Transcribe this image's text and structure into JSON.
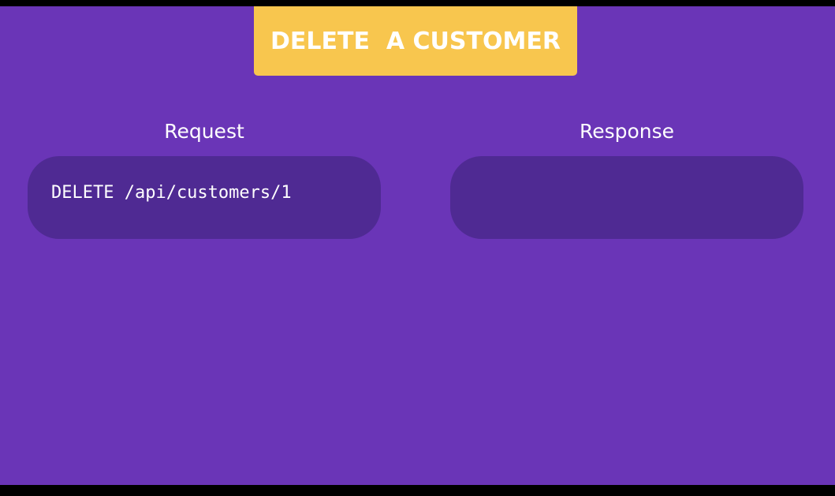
{
  "title": "DELETE  A CUSTOMER",
  "request": {
    "heading": "Request",
    "code": "DELETE /api/customers/1"
  },
  "response": {
    "heading": "Response",
    "code": ""
  },
  "colors": {
    "background": "#6a35b7",
    "banner": "#f8c64e",
    "box": "#4f2a93",
    "text": "#ffffff"
  }
}
